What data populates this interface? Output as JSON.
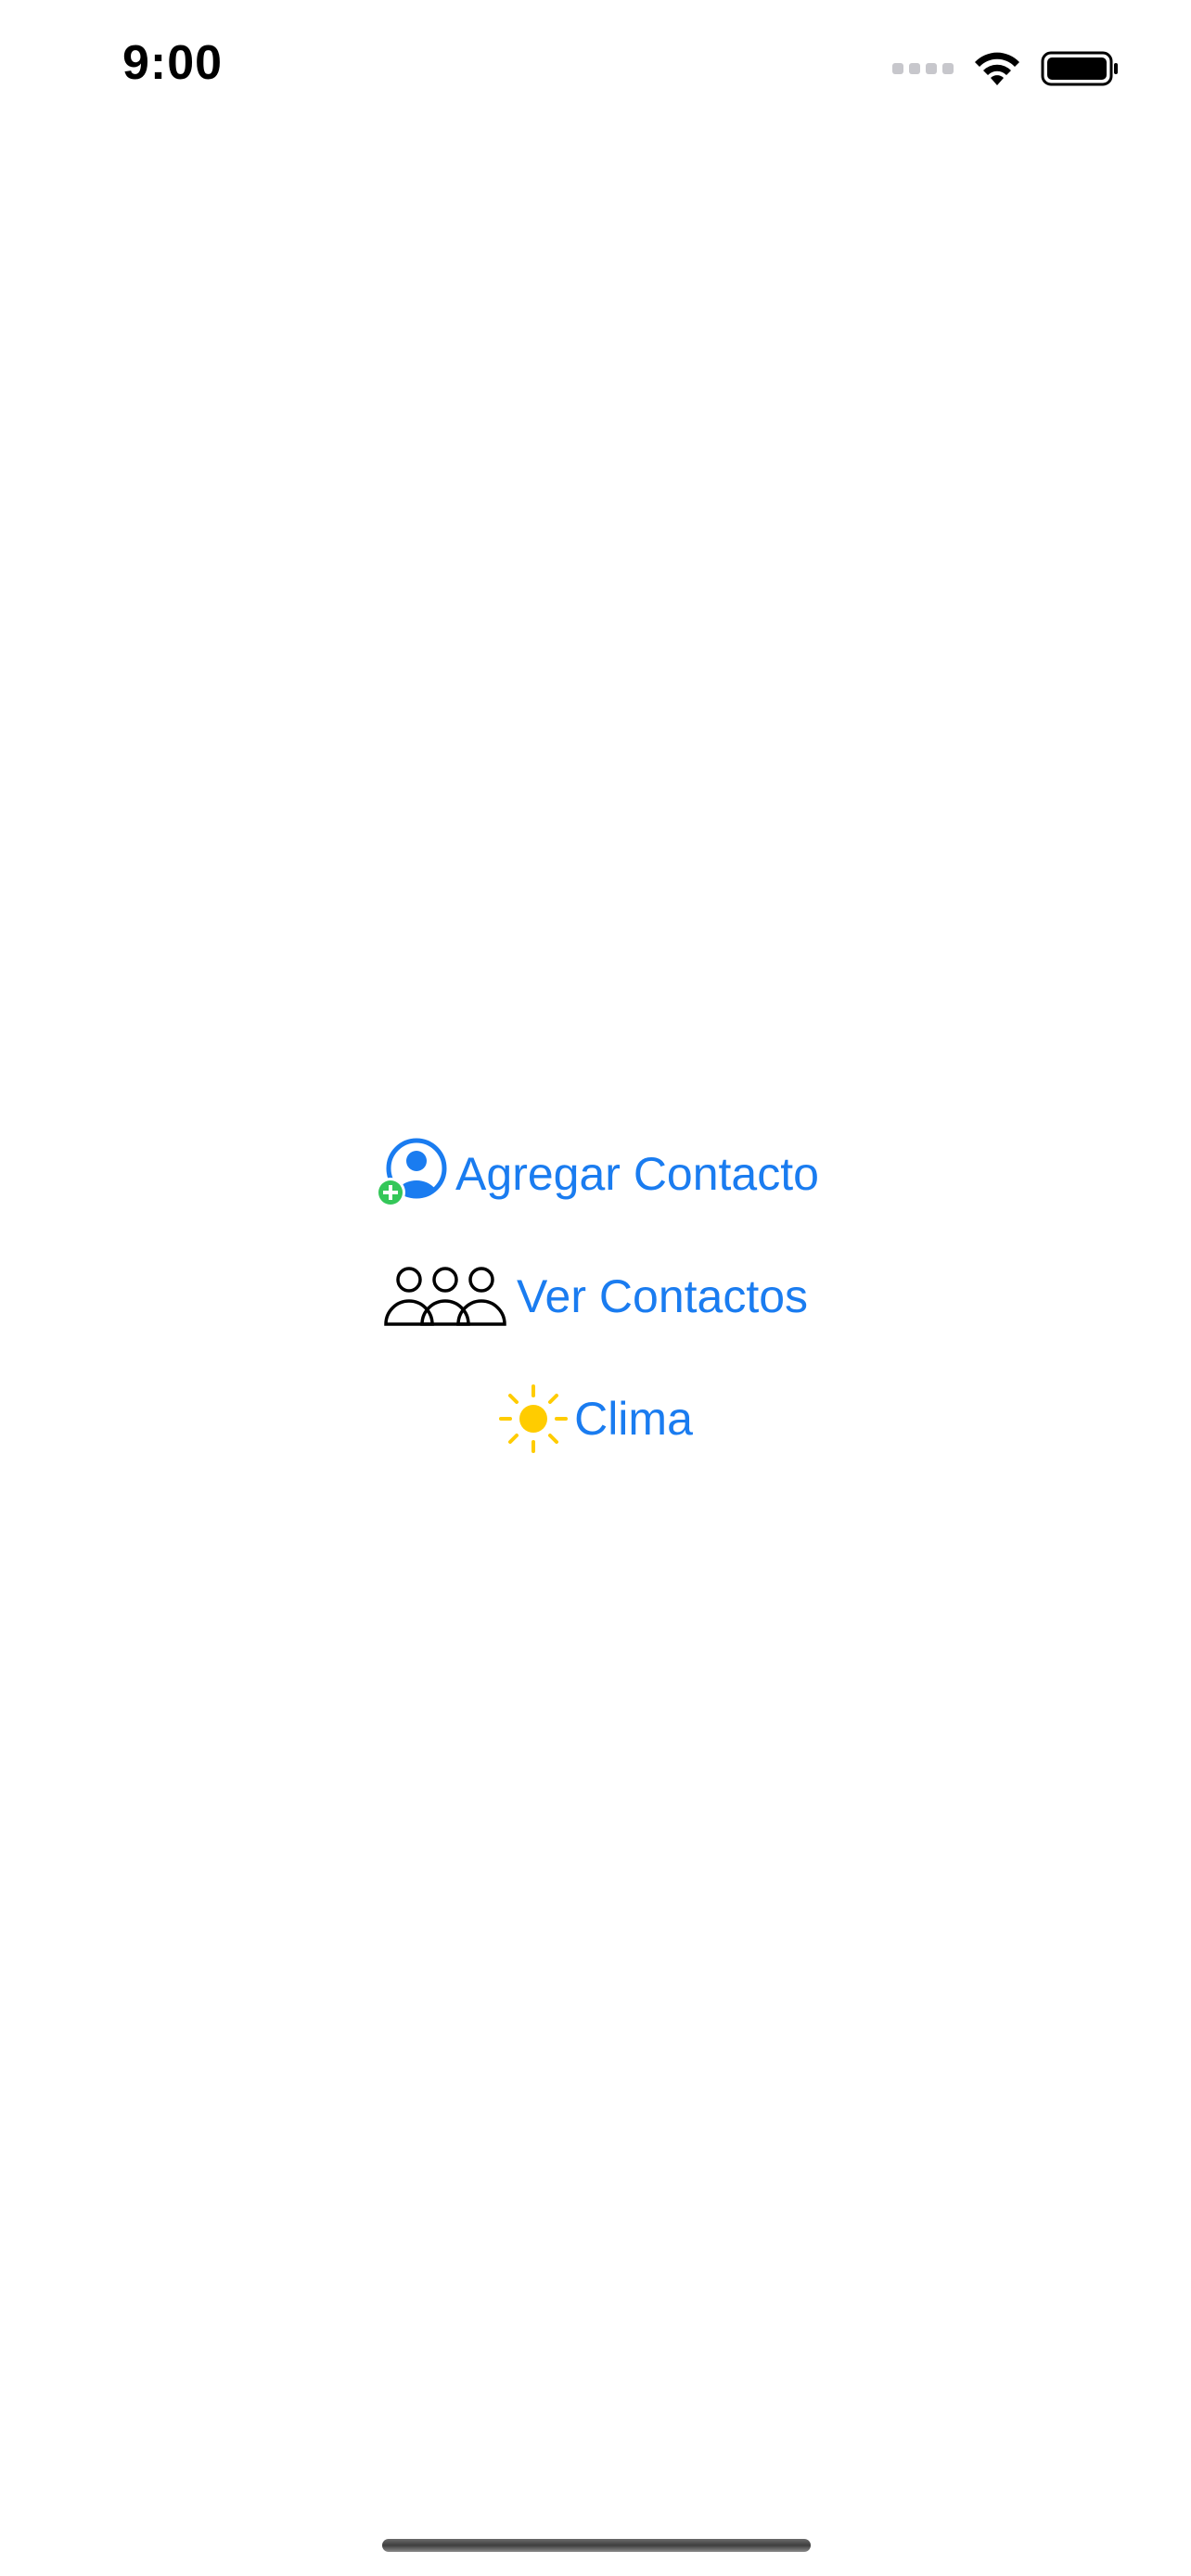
{
  "status_bar": {
    "time": "9:00",
    "icons": [
      "cellular-signal-icon",
      "wifi-icon",
      "battery-icon"
    ]
  },
  "menu": {
    "items": [
      {
        "label": "Agregar Contacto",
        "icon": "add-contact-icon"
      },
      {
        "label": "Ver Contactos",
        "icon": "people-group-icon"
      },
      {
        "label": "Clima",
        "icon": "sun-icon"
      }
    ]
  },
  "colors": {
    "accent": "#1a7cf0",
    "add_badge": "#34c759",
    "sun": "#ffcc00",
    "icon_outline": "#000000"
  }
}
